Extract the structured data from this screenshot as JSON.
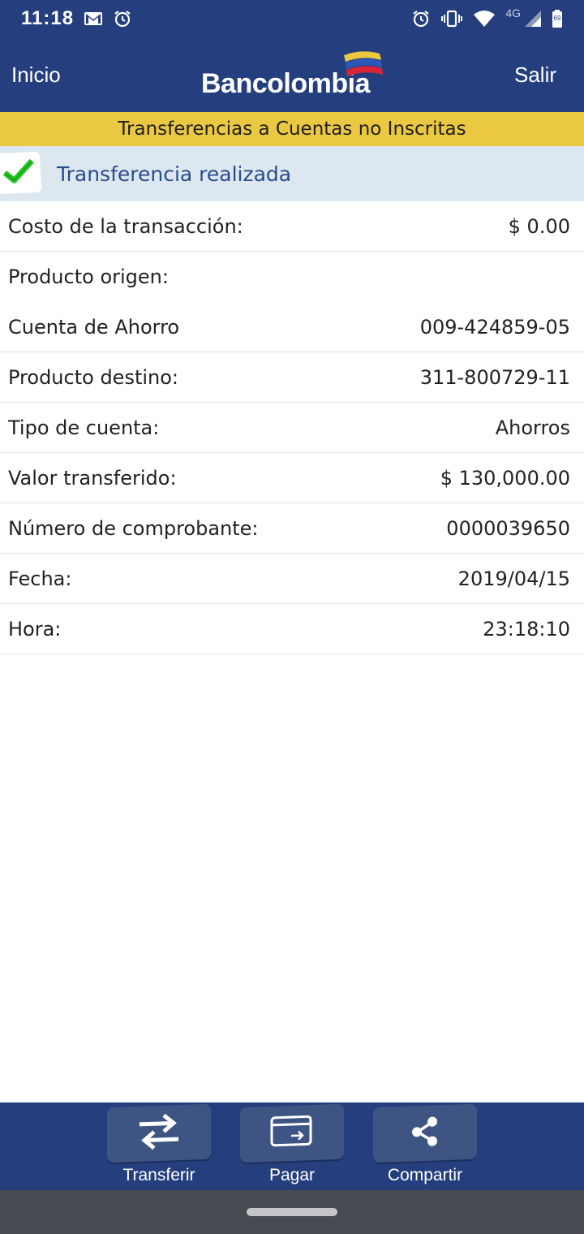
{
  "status_bar": {
    "time": "11:18",
    "network": "4G",
    "battery": "69",
    "icons": [
      "gmail-icon",
      "alarm-icon",
      "alarm-icon",
      "vibrate-icon",
      "wifi-icon",
      "signal-icon",
      "battery-icon"
    ]
  },
  "app_bar": {
    "left_label": "Inicio",
    "brand": "Bancolombia",
    "right_label": "Salir"
  },
  "section_title": "Transferencias a Cuentas no Inscritas",
  "success": {
    "message": "Transferencia realizada",
    "icon": "checkmark-icon"
  },
  "details": [
    {
      "label": "Costo de la transacción:",
      "value": "$ 0.00"
    },
    {
      "label": "Producto origen:",
      "value": ""
    },
    {
      "label": "Cuenta de Ahorro",
      "value": "009-424859-05"
    },
    {
      "label": "Producto destino:",
      "value": "311-800729-11"
    },
    {
      "label": "Tipo de cuenta:",
      "value": "Ahorros"
    },
    {
      "label": "Valor transferido:",
      "value": "$ 130,000.00"
    },
    {
      "label": "Número de comprobante:",
      "value": "0000039650"
    },
    {
      "label": "Fecha:",
      "value": "2019/04/15"
    },
    {
      "label": "Hora:",
      "value": "23:18:10"
    }
  ],
  "actions": [
    {
      "label": "Transferir",
      "icon": "transfer-arrows-icon"
    },
    {
      "label": "Pagar",
      "icon": "card-pay-icon"
    },
    {
      "label": "Compartir",
      "icon": "share-icon"
    }
  ],
  "colors": {
    "primary": "#253f7e",
    "accent_yellow": "#ebc841",
    "success_bg": "#dde7ef",
    "success_text": "#2a4b8d",
    "check_green": "#22c422"
  }
}
